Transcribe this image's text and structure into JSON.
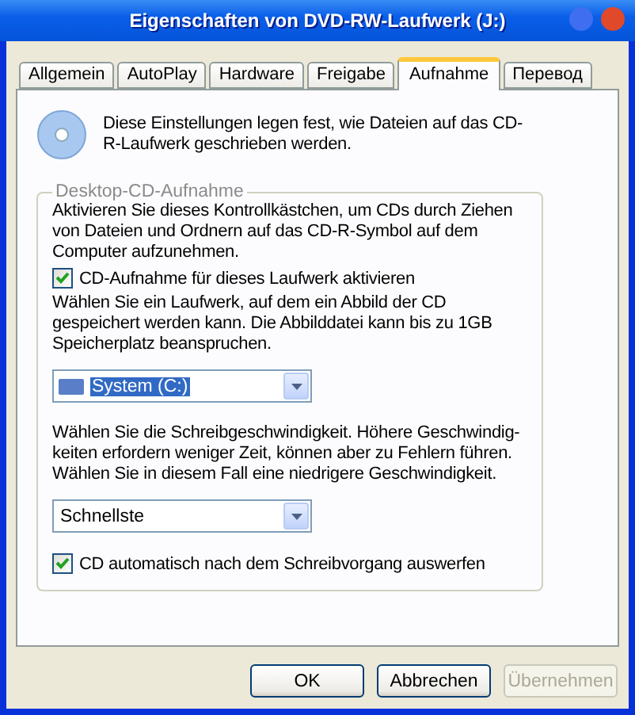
{
  "window": {
    "title": "Eigenschaften von DVD-RW-Laufwerk (J:)"
  },
  "tabs": [
    {
      "label": "Allgemein",
      "selected": false
    },
    {
      "label": "AutoPlay",
      "selected": false
    },
    {
      "label": "Hardware",
      "selected": false
    },
    {
      "label": "Freigabe",
      "selected": false
    },
    {
      "label": "Aufnahme",
      "selected": true
    },
    {
      "label": "Перевод",
      "selected": false
    }
  ],
  "intro": "Diese Einstellungen legen fest, wie Dateien auf das CD-R-Laufwerk geschrieben werden.",
  "group": {
    "title": "Desktop-CD-Aufnahme",
    "items": [
      {
        "kind": "text",
        "text": "Aktivieren Sie dieses Kontrollkästchen, um CDs durch Ziehen von Dateien und Ordnern auf das CD-R-Symbol auf dem Computer aufzunehmen."
      },
      {
        "kind": "checkbox",
        "label": "CD-Aufnahme für dieses Laufwerk aktivieren",
        "checked": true
      },
      {
        "kind": "text",
        "text": "Wählen Sie ein Laufwerk, auf dem ein Abbild der CD gespeichert werden kann. Die Abbilddatei kann bis zu 1GB Speicherplatz beanspruchen."
      },
      {
        "kind": "dropdown",
        "value": "System (C:)",
        "selected": true
      },
      {
        "kind": "text",
        "text": "Wählen Sie die Schreibgeschwindigkeit. Höhere Geschwindig-keiten erfordern weniger Zeit, können aber zu Fehlern führen. Wählen Sie in diesem Fall eine niedrigere Geschwindigkeit."
      },
      {
        "kind": "dropdown",
        "value": "Schnellste",
        "selected": false
      },
      {
        "kind": "checkbox",
        "label": "CD automatisch nach dem Schreibvorgang auswerfen",
        "checked": true
      }
    ]
  },
  "buttons": [
    {
      "label": "OK",
      "disabled": false
    },
    {
      "label": "Abbrechen",
      "disabled": false
    },
    {
      "label": "Übernehmen",
      "disabled": true
    }
  ]
}
